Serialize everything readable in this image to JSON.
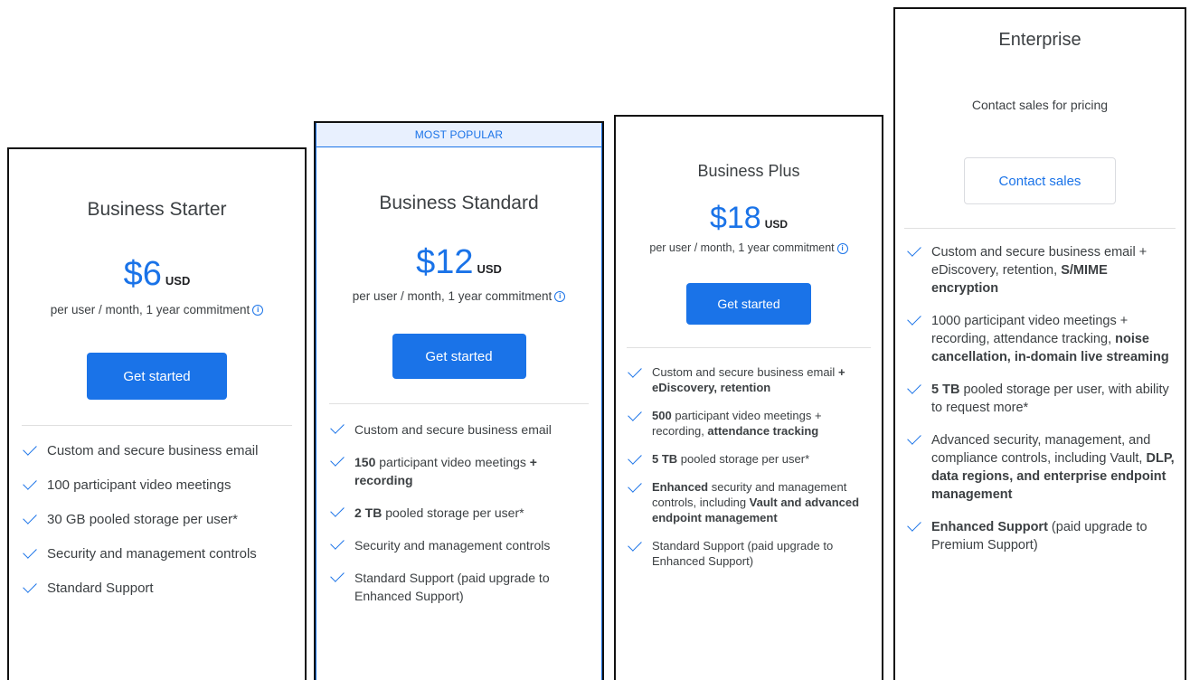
{
  "plans": [
    {
      "name": "Business Starter",
      "price": "$6",
      "currency": "USD",
      "commitment": "per user / month, 1 year commitment",
      "button": "Get started",
      "features": [
        [
          {
            "t": "Custom and secure business email",
            "b": false
          }
        ],
        [
          {
            "t": "100 participant video meetings",
            "b": false
          }
        ],
        [
          {
            "t": "30 GB pooled storage per user*",
            "b": false
          }
        ],
        [
          {
            "t": "Security and management controls",
            "b": false
          }
        ],
        [
          {
            "t": "Standard Support",
            "b": false
          }
        ]
      ]
    },
    {
      "badge": "MOST POPULAR",
      "name": "Business Standard",
      "price": "$12",
      "currency": "USD",
      "commitment": "per user / month, 1 year commitment",
      "button": "Get started",
      "features": [
        [
          {
            "t": "Custom and secure business email",
            "b": false
          }
        ],
        [
          {
            "t": "150",
            "b": true
          },
          {
            "t": " participant video meetings ",
            "b": false
          },
          {
            "t": "+ recording",
            "b": true
          }
        ],
        [
          {
            "t": "2 TB",
            "b": true
          },
          {
            "t": " pooled storage per user*",
            "b": false
          }
        ],
        [
          {
            "t": "Security and management controls",
            "b": false
          }
        ],
        [
          {
            "t": "Standard Support (paid upgrade to Enhanced Support)",
            "b": false
          }
        ]
      ]
    },
    {
      "name": "Business Plus",
      "price": "$18",
      "currency": "USD",
      "commitment": "per user / month, 1 year commitment",
      "button": "Get started",
      "features": [
        [
          {
            "t": "Custom and secure business email ",
            "b": false
          },
          {
            "t": "+ eDiscovery, retention",
            "b": true
          }
        ],
        [
          {
            "t": "500",
            "b": true
          },
          {
            "t": " participant video meetings + recording, ",
            "b": false
          },
          {
            "t": "attendance tracking",
            "b": true
          }
        ],
        [
          {
            "t": "5 TB",
            "b": true
          },
          {
            "t": " pooled storage per user*",
            "b": false
          }
        ],
        [
          {
            "t": "Enhanced",
            "b": true
          },
          {
            "t": " security and management controls, including ",
            "b": false
          },
          {
            "t": "Vault and advanced endpoint management",
            "b": true
          }
        ],
        [
          {
            "t": "Standard Support (paid upgrade to Enhanced Support)",
            "b": false
          }
        ]
      ]
    },
    {
      "name": "Enterprise",
      "contact_text": "Contact sales for pricing",
      "button": "Contact sales",
      "features": [
        [
          {
            "t": "Custom and secure business email + eDiscovery, retention, ",
            "b": false
          },
          {
            "t": "S/MIME encryption",
            "b": true
          }
        ],
        [
          {
            "t": "1000 participant video meetings + recording, attendance tracking, ",
            "b": false
          },
          {
            "t": "noise cancellation, in-domain live streaming",
            "b": true
          }
        ],
        [
          {
            "t": "5 TB",
            "b": true
          },
          {
            "t": " pooled storage per user, with ability to request more*",
            "b": false
          }
        ],
        [
          {
            "t": "Advanced security, management, and compliance controls, including Vault, ",
            "b": false
          },
          {
            "t": "DLP, data regions, and enterprise endpoint management",
            "b": true
          }
        ],
        [
          {
            "t": "Enhanced Support",
            "b": true
          },
          {
            "t": " (paid upgrade to Premium Support)",
            "b": false
          }
        ]
      ]
    }
  ],
  "icons": {
    "check": "check-icon",
    "info": "info-icon"
  },
  "colors": {
    "accent": "#1a73e8",
    "badge_bg": "#e8f0fe"
  }
}
